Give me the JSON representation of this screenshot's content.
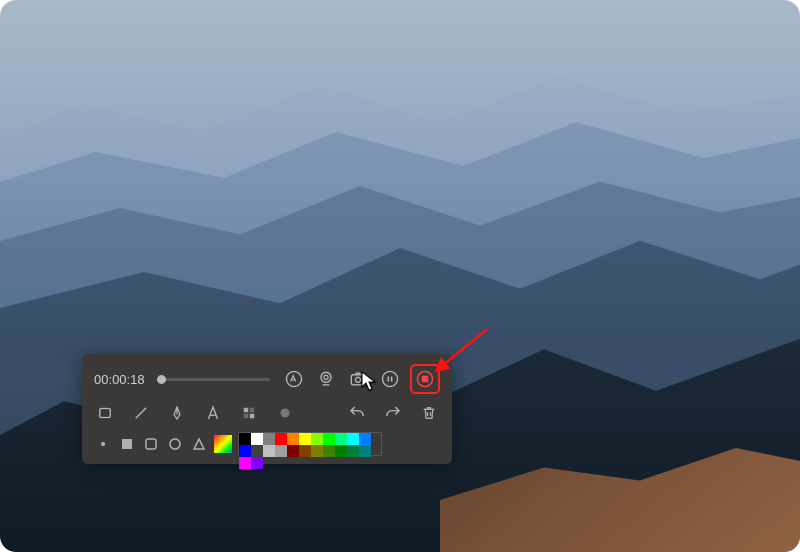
{
  "recorder": {
    "timer": "00:00:18",
    "row1": {
      "annotate_pen": "annotate-pen",
      "webcam": "webcam",
      "camera": "screenshot",
      "pause": "pause",
      "stop": "stop"
    },
    "row2": {
      "rectangle": "rectangle-tool",
      "line": "line-tool",
      "pen": "pen-tool",
      "text": "text-tool",
      "blur": "blur-tool",
      "dot": "dot-tool",
      "undo": "undo",
      "redo": "redo",
      "trash": "delete"
    },
    "row3": {
      "shapes": [
        "filled-square",
        "outline-square",
        "rounded-square",
        "circle",
        "triangle"
      ],
      "gradient": "color-picker"
    },
    "palette": [
      "#000000",
      "#ffffff",
      "#808080",
      "#ff0000",
      "#ff8000",
      "#ffff00",
      "#80ff00",
      "#00ff00",
      "#00ff80",
      "#00ffff",
      "#0080ff",
      "#0000ff",
      "#404040",
      "#c0c0c0",
      "#a0a0a0",
      "#800000",
      "#804000",
      "#808000",
      "#408000",
      "#008000",
      "#008040",
      "#008080",
      "#ff00ff",
      "#8000ff"
    ]
  },
  "annotation": {
    "highlight": "stop-button",
    "arrow_color": "#ff1010"
  }
}
